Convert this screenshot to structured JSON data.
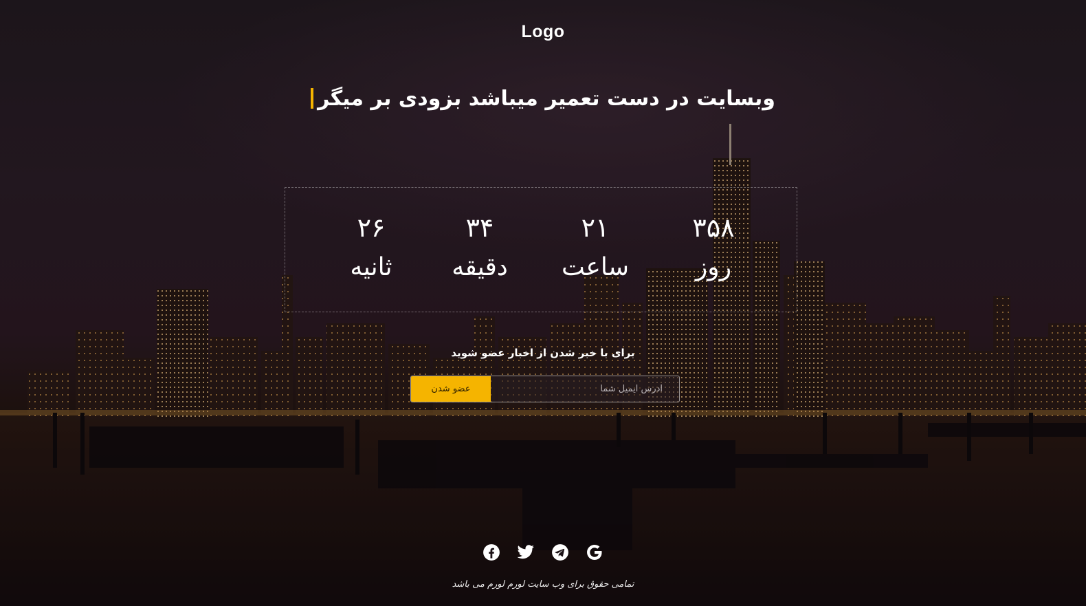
{
  "header": {
    "logo": "Logo"
  },
  "hero": {
    "headline": "وبسایت در دست تعمیر میباشد بزودی بر میگر"
  },
  "countdown": {
    "days": {
      "value": "۳۵۸",
      "label": "روز"
    },
    "hours": {
      "value": "۲۱",
      "label": "ساعت"
    },
    "minutes": {
      "value": "۳۴",
      "label": "دقیقه"
    },
    "seconds": {
      "value": "۲۶",
      "label": "ثانیه"
    }
  },
  "subscribe": {
    "text": "برای با خبر شدن از اخبار عضو شوید",
    "email_placeholder": "آدرس ایمیل شما",
    "button_label": "عضو شدن"
  },
  "socials": [
    "facebook-icon",
    "twitter-icon",
    "telegram-icon",
    "google-icon"
  ],
  "colors": {
    "accent": "#f5b400",
    "text": "#ffffff"
  },
  "footer": {
    "copyright": "تمامی حقوق برای وب سایت لورم لورم می باشد"
  }
}
